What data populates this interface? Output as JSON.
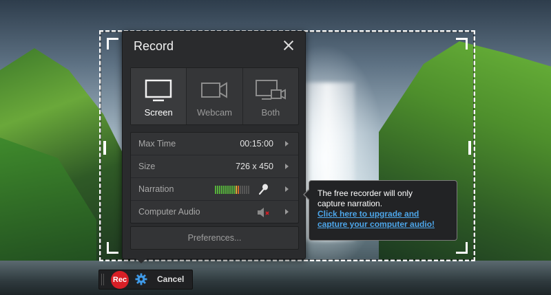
{
  "panel": {
    "title": "Record",
    "modes": [
      {
        "label": "Screen",
        "icon": "monitor-icon",
        "active": true
      },
      {
        "label": "Webcam",
        "icon": "webcam-icon",
        "active": false
      },
      {
        "label": "Both",
        "icon": "monitor-webcam-icon",
        "active": false
      }
    ],
    "settings": {
      "max_time": {
        "label": "Max Time",
        "value": "00:15:00"
      },
      "size": {
        "label": "Size",
        "value": "726 x 450"
      },
      "narration": {
        "label": "Narration",
        "meter_icon": "audio-level-meter-icon",
        "icon": "microphone-icon"
      },
      "computer_audio": {
        "label": "Computer Audio",
        "icon": "speaker-muted-icon"
      }
    },
    "preferences_label": "Preferences..."
  },
  "tooltip": {
    "text_line1": "The free recorder will only",
    "text_line2": "capture narration.",
    "link_line1": "Click here to upgrade and",
    "link_line2": "capture your computer audio!"
  },
  "toolbar": {
    "rec_label": "Rec",
    "settings_icon": "gear-icon",
    "cancel_label": "Cancel"
  },
  "colors": {
    "accent_red": "#d81f26",
    "link_blue": "#4da6ea",
    "panel_bg": "#2a2b2d"
  }
}
